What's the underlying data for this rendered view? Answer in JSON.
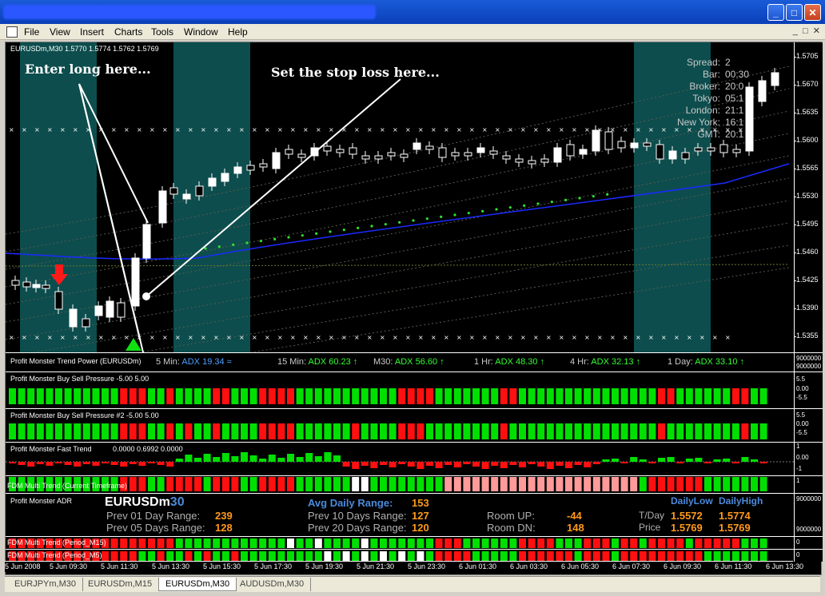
{
  "menu": [
    "File",
    "View",
    "Insert",
    "Charts",
    "Tools",
    "Window",
    "Help"
  ],
  "chart": {
    "symbol_title": "EURUSDm,M30  1.5770 1.5774 1.5762 1.5769",
    "annotation_long": "Enter long here...",
    "annotation_stop": "Set the stop loss here...",
    "price_ticks": [
      "1.5705",
      "1.5670",
      "1.5635",
      "1.5600",
      "1.5565",
      "1.5530",
      "1.5495",
      "1.5460",
      "1.5425",
      "1.5390",
      "1.5355"
    ],
    "info_labels": [
      "Spread:",
      "Bar:",
      "Broker:",
      "Tokyo:",
      "London:",
      "New York:",
      "GMT:"
    ],
    "info_values": [
      "2",
      "00:30",
      "20:0",
      "05:1",
      "21:1",
      "16:1",
      "20:1"
    ]
  },
  "trend_power": {
    "label": "Profit Monster Trend Power (EURUSDm)",
    "items": [
      {
        "tf": "5 Min:",
        "adx": "ADX 19.34",
        "arrow": "≈",
        "color": "#4aa0ff"
      },
      {
        "tf": "15 Min:",
        "adx": "ADX 60.23",
        "arrow": "↑",
        "color": "#30ff30"
      },
      {
        "tf": "M30:",
        "adx": "ADX 56.60",
        "arrow": "↑",
        "color": "#30ff30"
      },
      {
        "tf": "1 Hr:",
        "adx": "ADX 48.30",
        "arrow": "↑",
        "color": "#30ff30"
      },
      {
        "tf": "4 Hr:",
        "adx": "ADX 32.13",
        "arrow": "↑",
        "color": "#30ff30"
      },
      {
        "tf": "1 Day:",
        "adx": "ADX 33.10",
        "arrow": "↑",
        "color": "#30ff30"
      }
    ],
    "axis": [
      "9000000",
      "9000000"
    ]
  },
  "pressure1": {
    "label": "Profit Monster Buy Sell Pressure -5.00 5.00",
    "axis": [
      "5.5",
      "0.00",
      "-5.5"
    ]
  },
  "pressure2": {
    "label": "Profit Monster Buy Sell Pressure #2 -5.00 5.00",
    "axis": [
      "5.5",
      "0.00",
      "-5.5"
    ]
  },
  "fast_trend": {
    "label": "Profit Monster Fast Trend",
    "values": "0.0000 0.6992 0.0000",
    "axis": [
      "1",
      "0.00",
      "-1"
    ]
  },
  "multi_trend": {
    "label": "FDM Multi Trend (Current Timeframe)",
    "axis": [
      "1"
    ]
  },
  "adr": {
    "label": "Profit Monster ADR",
    "symbol_main": "EURUSDm",
    "symbol_tf": "30",
    "prev01_label": "Prev 01 Day Range:",
    "prev01": "239",
    "prev05_label": "Prev 05 Days Range:",
    "prev05": "128",
    "avg_label": "Avg Daily Range:",
    "avg": "153",
    "prev10_label": "Prev 10 Days Range:",
    "prev10": "127",
    "prev20_label": "Prev 20 Days Range:",
    "prev20": "120",
    "roomup_label": "Room UP:",
    "roomup": "-44",
    "roomdn_label": "Room DN:",
    "roomdn": "148",
    "dailylow_label": "DailyLow",
    "dailyhigh_label": "DailyHigh",
    "tday_label": "T/Day",
    "tday_low": "1.5572",
    "tday_high": "1.5774",
    "price_label": "Price",
    "price_low": "1.5769",
    "price_high": "1.5769",
    "axis": [
      "9000000",
      "9000000"
    ]
  },
  "mt15": {
    "label": "FDM Multi Trend (Period_M15)",
    "axis": [
      "0"
    ]
  },
  "mt5": {
    "label": "FDM Multi Trend (Period_M5)",
    "axis": [
      "0"
    ]
  },
  "time_labels": [
    "5 Jun 2008",
    "5 Jun 09:30",
    "5 Jun 11:30",
    "5 Jun 13:30",
    "5 Jun 15:30",
    "5 Jun 17:30",
    "5 Jun 19:30",
    "5 Jun 21:30",
    "5 Jun 23:30",
    "6 Jun 01:30",
    "6 Jun 03:30",
    "6 Jun 05:30",
    "6 Jun 07:30",
    "6 Jun 09:30",
    "6 Jun 11:30",
    "6 Jun 13:30"
  ],
  "tabs": [
    "EURJPYm,M30",
    "EURUSDm,M15",
    "EURUSDm,M30",
    "AUDUSDm,M30"
  ],
  "active_tab": 2,
  "colors": {
    "bull": "#00e000",
    "bear": "#ff1010",
    "teal": "#0d4d4d",
    "ma": "#1a2aff",
    "dots": "#ffffff"
  }
}
